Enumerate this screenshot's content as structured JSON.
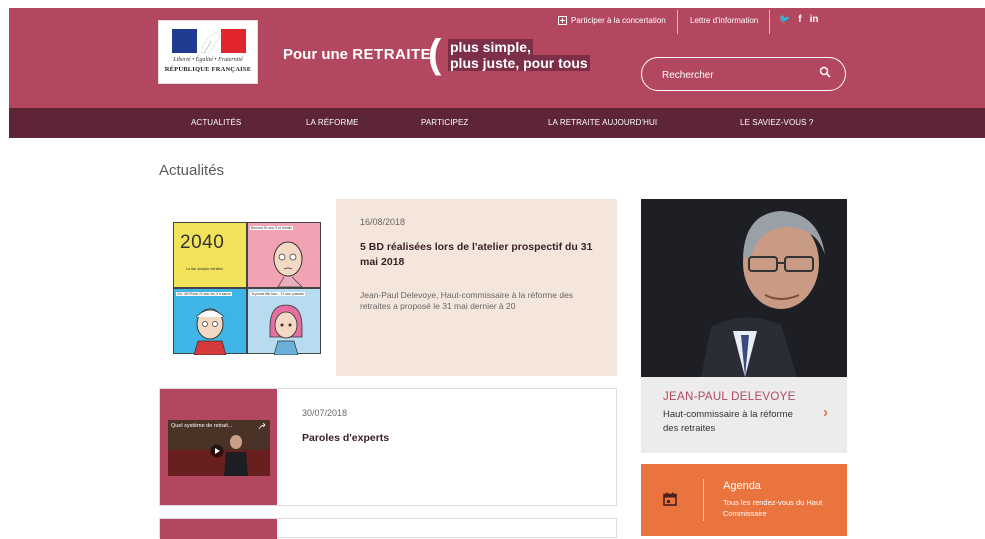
{
  "header": {
    "logo": {
      "motto": "Liberté • Égalité • Fraternité",
      "republic": "RÉPUBLIQUE FRANÇAISE"
    },
    "tagline_prefix": "Pour une",
    "tagline_emphasis": "RETRAITE",
    "slogan_line1": "plus simple,",
    "slogan_line2": "plus juste, pour tous",
    "top_links": {
      "participate": "Participer à la concertation",
      "newsletter": "Lettre d'information"
    },
    "social": [
      "twitter-icon",
      "facebook-icon",
      "linkedin-icon"
    ],
    "social_glyphs": {
      "twitter": "🐦",
      "facebook": "f",
      "linkedin": "in"
    },
    "search": {
      "placeholder": "Rechercher"
    }
  },
  "nav": {
    "items": [
      {
        "label": "ACTUALITÉS"
      },
      {
        "label": "LA RÉFORME"
      },
      {
        "label": "PARTICIPEZ"
      },
      {
        "label": "LA RETRAITE AUJOURD'HUI"
      },
      {
        "label": "LE SAVIEZ-VOUS ?"
      }
    ]
  },
  "main": {
    "title": "Actualités",
    "articles": [
      {
        "date": "16/08/2018",
        "title": "5 BD réalisées lors de l'atelier prospectif du 31 mai 2018",
        "excerpt": "Jean-Paul Delevoye, Haut-commissaire à la réforme des retraites a proposé le 31 mai dernier à 20",
        "comic": {
          "year": "2040",
          "caption1": "La fiac analyse retraites",
          "caption2": "Bernard 30 ans, 5 et retraite",
          "caption3": "Gio, 48 Rhone 20 ans net, 5 à cause",
          "caption4": "Ta pense fille fran... 31 ans, pasnato"
        }
      },
      {
        "date": "30/07/2018",
        "title": "Paroles d'experts",
        "video_title": "Quel système de retrait..."
      }
    ]
  },
  "sidebar": {
    "profile": {
      "name": "JEAN-PAUL DELEVOYE",
      "role": "Haut-commissaire à la réforme des retraites",
      "arrow": "›"
    },
    "agenda": {
      "title": "Agenda",
      "subtitle": "Tous les rendez-vous du Haut Commissaire"
    }
  },
  "colors": {
    "brand": "#b2475f",
    "nav": "#5d2535",
    "accent_orange": "#e9743e",
    "card_bg": "#f5e6dc"
  }
}
